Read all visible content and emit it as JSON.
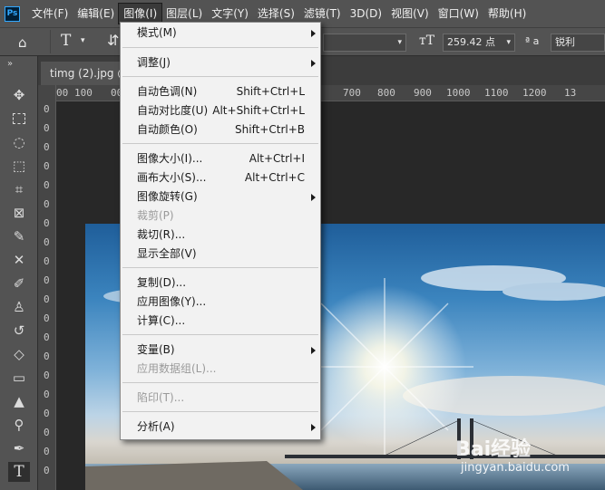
{
  "menubar": {
    "logo": "Ps",
    "items": [
      "文件(F)",
      "编辑(E)",
      "图像(I)",
      "图层(L)",
      "文字(Y)",
      "选择(S)",
      "滤镜(T)",
      "3D(D)",
      "视图(V)",
      "窗口(W)",
      "帮助(H)"
    ],
    "active_index": 2
  },
  "options": {
    "font_size": "259.42 点",
    "aa_label": "ª a",
    "antialias": "锐利"
  },
  "document": {
    "tab_title": "timg (2).jpg @"
  },
  "rulers": {
    "top": [
      "00",
      "100",
      "00",
      "700",
      "800",
      "900",
      "1000",
      "1100",
      "1200",
      "13"
    ],
    "left": [
      "0",
      "0",
      "0",
      "0",
      "0",
      "0",
      "0",
      "0",
      "0",
      "0",
      "0",
      "0",
      "0",
      "0",
      "0",
      "0",
      "0",
      "0",
      "0",
      "0"
    ]
  },
  "dropdown": {
    "items": [
      {
        "label": "模式(M)",
        "submenu": true
      },
      {
        "label": "调整(J)",
        "submenu": true
      },
      {
        "label": "自动色调(N)",
        "shortcut": "Shift+Ctrl+L"
      },
      {
        "label": "自动对比度(U)",
        "shortcut": "Alt+Shift+Ctrl+L"
      },
      {
        "label": "自动颜色(O)",
        "shortcut": "Shift+Ctrl+B"
      },
      {
        "label": "图像大小(I)...",
        "shortcut": "Alt+Ctrl+I"
      },
      {
        "label": "画布大小(S)...",
        "shortcut": "Alt+Ctrl+C"
      },
      {
        "label": "图像旋转(G)",
        "submenu": true
      },
      {
        "label": "裁剪(P)",
        "disabled": true
      },
      {
        "label": "裁切(R)..."
      },
      {
        "label": "显示全部(V)"
      },
      {
        "label": "复制(D)..."
      },
      {
        "label": "应用图像(Y)..."
      },
      {
        "label": "计算(C)..."
      },
      {
        "label": "变量(B)",
        "submenu": true
      },
      {
        "label": "应用数据组(L)...",
        "disabled": true
      },
      {
        "label": "陷印(T)...",
        "disabled": true
      },
      {
        "label": "分析(A)",
        "submenu": true
      }
    ]
  },
  "watermark": {
    "brand": "Bai经验",
    "url": "jingyan.baidu.com"
  }
}
